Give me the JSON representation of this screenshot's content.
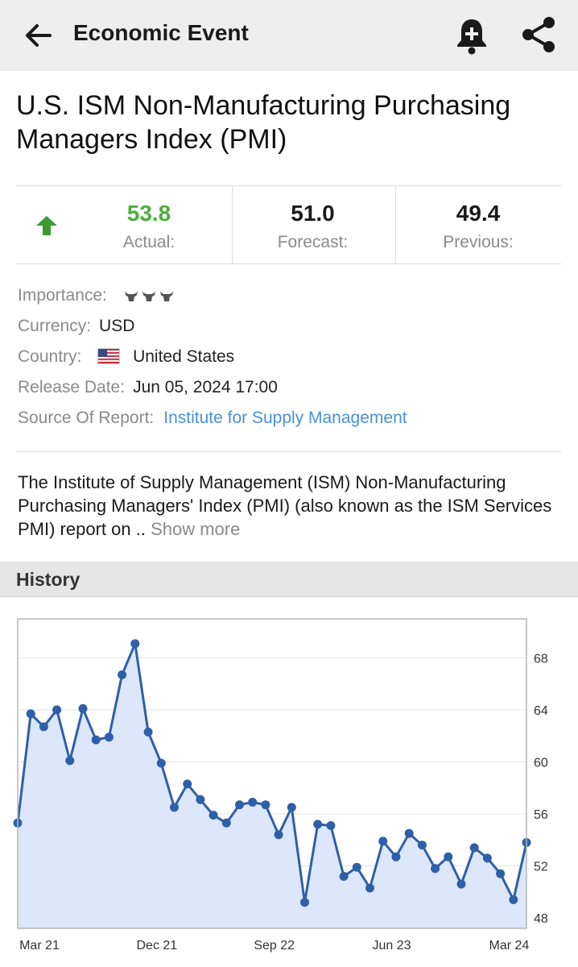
{
  "appbar": {
    "title": "Economic Event",
    "icons": [
      "back-arrow-icon",
      "add-alert-bell-icon",
      "share-icon"
    ]
  },
  "event": {
    "title": "U.S. ISM Non-Manufacturing Purchasing Managers Index (PMI)"
  },
  "stats": {
    "actual_value": "53.8",
    "actual_label": "Actual:",
    "forecast_value": "51.0",
    "forecast_label": "Forecast:",
    "previous_value": "49.4",
    "previous_label": "Previous:",
    "trend": "up",
    "colors": {
      "actual": "#4caf3c",
      "arrow": "#3c9a33"
    }
  },
  "details": {
    "importance_label": "Importance:",
    "importance_level": 3,
    "currency_label": "Currency:",
    "currency_value": "USD",
    "country_label": "Country:",
    "country_value": "United States",
    "release_label": "Release Date:",
    "release_value": "Jun 05, 2024 17:00",
    "source_label": "Source Of Report:",
    "source_value": "Institute for Supply Management",
    "link_color": "#4a90d9"
  },
  "description": {
    "text": "The Institute of Supply Management (ISM) Non-Manufacturing Purchasing Managers' Index (PMI) (also known as the ISM Services PMI) report on ..",
    "more_label": "Show more"
  },
  "history": {
    "section_label": "History"
  },
  "chart_data": {
    "type": "area",
    "x_tick_labels": [
      "Mar 21",
      "Dec 21",
      "Sep 22",
      "Jun 23",
      "Mar 24"
    ],
    "y_ticks": [
      48,
      52,
      56,
      60,
      64,
      68
    ],
    "ylim": [
      47.2,
      71.0
    ],
    "y_axis_position": "right",
    "grid": true,
    "line_color": "#2f5fa8",
    "fill_color": "#dce7fb",
    "values": [
      55.3,
      63.7,
      62.7,
      64.0,
      60.1,
      64.1,
      61.7,
      61.9,
      66.7,
      69.1,
      62.3,
      59.9,
      56.5,
      58.3,
      57.1,
      55.9,
      55.3,
      56.7,
      56.9,
      56.7,
      54.4,
      56.5,
      49.2,
      55.2,
      55.1,
      51.2,
      51.9,
      50.3,
      53.9,
      52.7,
      54.5,
      53.6,
      51.8,
      52.7,
      50.6,
      53.4,
      52.6,
      51.4,
      49.4,
      53.8
    ]
  }
}
